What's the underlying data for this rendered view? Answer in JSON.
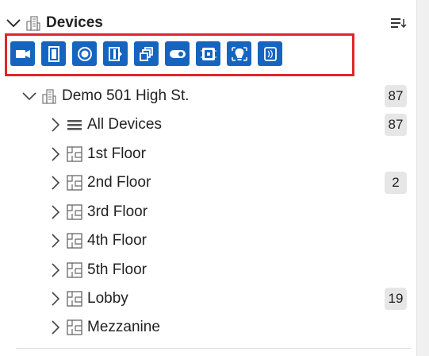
{
  "header": {
    "title": "Devices"
  },
  "toolbar": {
    "buttons": [
      {
        "icon": "camera-icon"
      },
      {
        "icon": "door-icon"
      },
      {
        "icon": "sensor-icon"
      },
      {
        "icon": "reader-icon"
      },
      {
        "icon": "stack-icon"
      },
      {
        "icon": "toggle-icon"
      },
      {
        "icon": "panel-icon"
      },
      {
        "icon": "bulb-icon"
      },
      {
        "icon": "device-icon"
      }
    ],
    "accent": "#1565c0",
    "highlight": "#e3242b"
  },
  "tree": {
    "site": {
      "label": "Demo 501 High St.",
      "count": "87"
    },
    "items": [
      {
        "label": "All Devices",
        "count": "87"
      },
      {
        "label": "1st Floor",
        "count": ""
      },
      {
        "label": "2nd Floor",
        "count": "2"
      },
      {
        "label": "3rd Floor",
        "count": ""
      },
      {
        "label": "4th Floor",
        "count": ""
      },
      {
        "label": "5th Floor",
        "count": ""
      },
      {
        "label": "Lobby",
        "count": "19"
      },
      {
        "label": "Mezzanine",
        "count": ""
      }
    ]
  }
}
